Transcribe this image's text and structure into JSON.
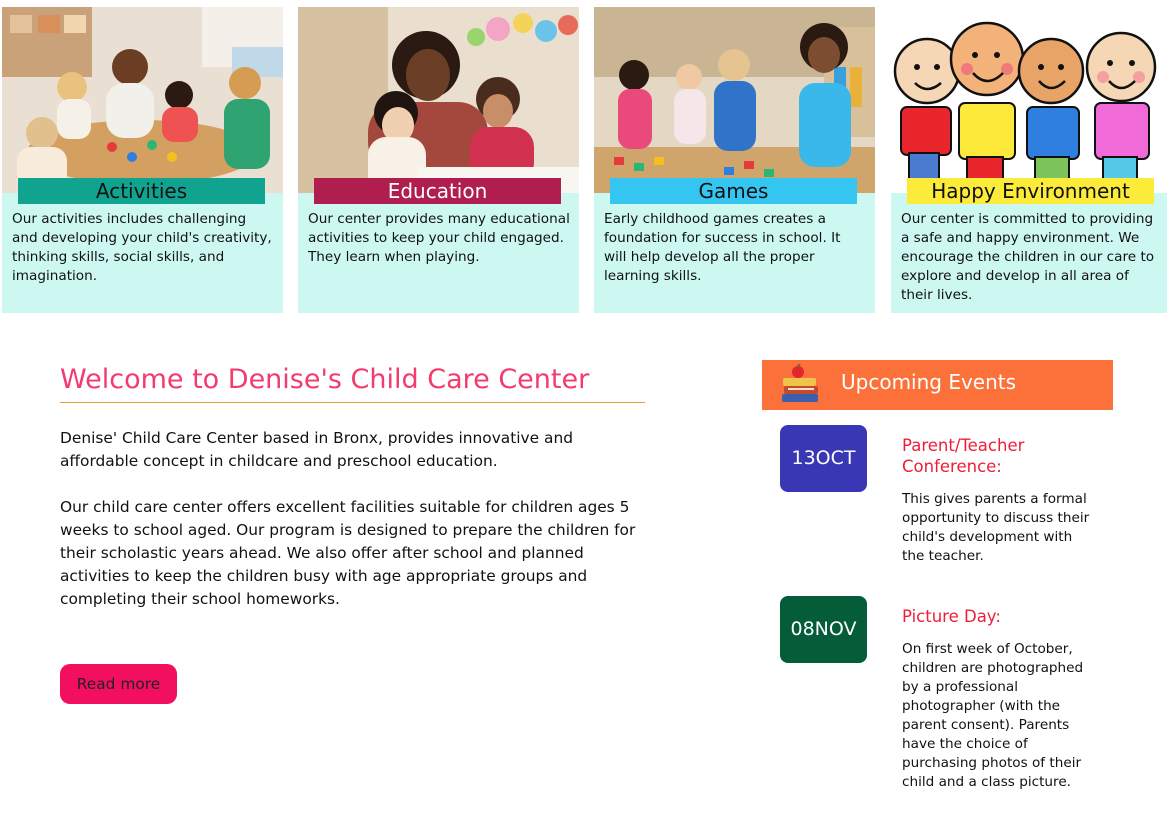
{
  "cards": [
    {
      "title": "Activities",
      "text": "Our activities includes challenging and developing your child's creativity, thinking skills, social skills, and imagination.",
      "image": "classroom-activity-photo",
      "tag_color": "#10a490"
    },
    {
      "title": "Education",
      "text": "Our center provides many educational activities to keep your child engaged. They learn when playing.",
      "image": "teacher-with-children-photo",
      "tag_color": "#b01e4f"
    },
    {
      "title": "Games",
      "text": "Early childhood games creates a foundation for success in school. It will help develop all the proper learning skills.",
      "image": "children-playing-photo",
      "tag_color": "#34c6f1"
    },
    {
      "title": "Happy Environment",
      "text": "Our center is committed to providing a safe and happy environment. We encourage the children in our care to explore and develop in all area of their lives.",
      "image": "cartoon-kids-illustration",
      "tag_color": "#fdeb3a"
    }
  ],
  "welcome": {
    "title": "Welcome to Denise's Child Care Center",
    "paragraph_1": "Denise' Child Care Center based in Bronx, provides innovative and affordable concept in childcare and preschool education.",
    "paragraph_2": "Our child care center offers excellent facilities suitable for children ages 5 weeks to school aged. Our program is designed to prepare the children for their scholastic years ahead. We also offer after school and planned activities to keep the children busy with age appropriate groups and completing their school homeworks.",
    "read_more_label": "Read more",
    "title_color": "#f33b6d",
    "button_color": "#f2105e"
  },
  "events": {
    "heading": "Upcoming Events",
    "heading_icon": "books-with-apple-icon",
    "heading_color": "#fb7139",
    "items": [
      {
        "date": "13OCT",
        "title": "Parent/Teacher Conference:",
        "text": "This gives parents a formal opportunity to discuss their child's development with the teacher.",
        "date_color": "#3a37b5"
      },
      {
        "date": "08NOV",
        "title": "Picture Day:",
        "text": "On first week of October, children are photographed by a professional photographer (with the parent consent). Parents have the choice of purchasing photos of their child and a class picture.",
        "date_color": "#045c39"
      }
    ]
  }
}
